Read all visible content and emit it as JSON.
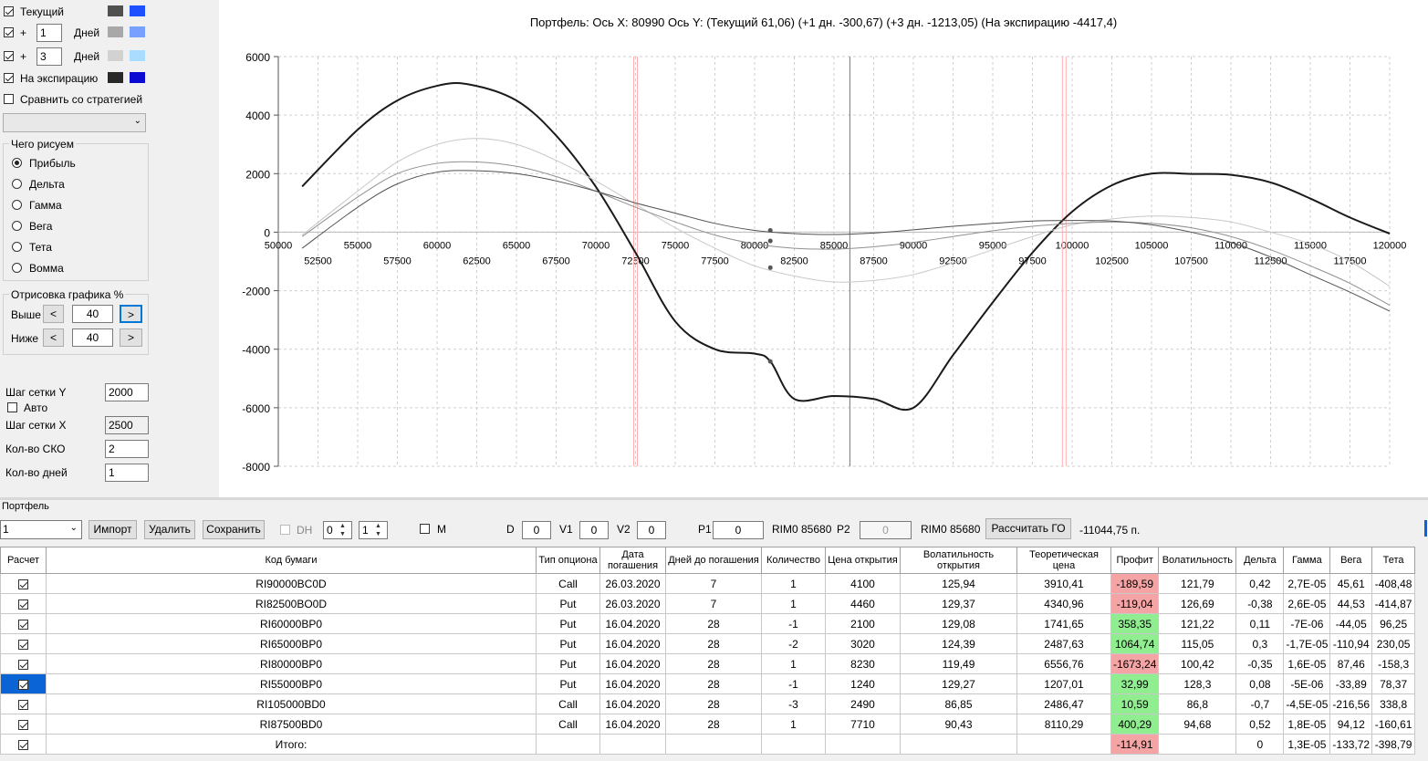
{
  "legend": {
    "current": {
      "label": "Текущий",
      "colors": [
        "#505050",
        "#1e50ff"
      ]
    },
    "plus1": {
      "prefix": "+",
      "days": "1",
      "suffix": "Дней",
      "colors": [
        "#a8a8a8",
        "#78a0ff"
      ]
    },
    "plus3": {
      "prefix": "+",
      "days": "3",
      "suffix": "Дней",
      "colors": [
        "#d2d2d2",
        "#aadcff"
      ]
    },
    "expiry": {
      "label": "На экспирацию",
      "colors": [
        "#282828",
        "#0a0ad2"
      ]
    },
    "compare": {
      "label": "Сравнить со стратегией"
    }
  },
  "draw_group": {
    "title": "Чего рисуем",
    "options": [
      "Прибыль",
      "Дельта",
      "Гамма",
      "Вега",
      "Тета",
      "Вомма"
    ],
    "selected": "Прибыль"
  },
  "range_group": {
    "title": "Отрисовка графика %",
    "above_label": "Выше",
    "above_value": "40",
    "below_label": "Ниже",
    "below_value": "40",
    "dec": "<",
    "inc": ">"
  },
  "settings": {
    "grid_y_label": "Шаг сетки Y",
    "grid_y": "2000",
    "auto_label": "Авто",
    "grid_x_label": "Шаг сетки X",
    "grid_x": "2500",
    "sko_label": "Кол-во СКО",
    "sko": "2",
    "days_label": "Кол-во дней",
    "days": "1"
  },
  "chart_title": "Портфель: Ось X: 80990 Ось Y:  (Текущий 61,06)  (+1 дн. -300,67)  (+3 дн. -1213,05)  (На экспирацию -4417,4)",
  "chart_data": {
    "type": "line",
    "xlim": [
      50000,
      120000
    ],
    "ylim": [
      -8000,
      6000
    ],
    "yticks": [
      "6000",
      "4000",
      "2000",
      "0",
      "-2000",
      "-4000",
      "-6000",
      "-8000"
    ],
    "xticks_top": [
      "50000",
      "55000",
      "60000",
      "65000",
      "70000",
      "75000",
      "80000",
      "85000",
      "90000",
      "95000",
      "100000",
      "105000",
      "110000",
      "115000",
      "120000"
    ],
    "xticks_bottom": [
      "52500",
      "57500",
      "62500",
      "67500",
      "72500",
      "77500",
      "82500",
      "87500",
      "92500",
      "97500",
      "102500",
      "107500",
      "112500",
      "117500"
    ],
    "vlines": {
      "red": [
        72500,
        99500
      ],
      "blue": [
        86000
      ]
    },
    "series": [
      {
        "key": "expiry",
        "color": "#1a1a1a",
        "width": 2,
        "x": [
          51500,
          55000,
          57500,
          60000,
          62000,
          65000,
          67500,
          70000,
          72500,
          75000,
          77500,
          80000,
          81000,
          82500,
          85000,
          87500,
          90000,
          92500,
          95000,
          97500,
          100000,
          102500,
          105000,
          107500,
          110000,
          112500,
          115000,
          117500,
          120000
        ],
        "y": [
          1560,
          3500,
          4500,
          5000,
          5050,
          4500,
          3300,
          1550,
          -700,
          -3050,
          -4000,
          -4150,
          -4420,
          -5700,
          -5600,
          -5700,
          -6000,
          -4200,
          -2400,
          -700,
          700,
          1600,
          2000,
          1990,
          1960,
          1700,
          1150,
          500,
          -50
        ]
      },
      {
        "key": "plus3",
        "color": "#c8c8c8",
        "width": 1,
        "x": [
          51500,
          55000,
          57500,
          60000,
          62500,
          65000,
          67500,
          70000,
          72500,
          75000,
          77500,
          80000,
          82500,
          85000,
          87500,
          90000,
          92500,
          95000,
          97500,
          100000,
          102500,
          105000,
          107500,
          110000,
          112500,
          115000,
          117500,
          120000
        ],
        "y": [
          -100,
          1400,
          2400,
          3000,
          3200,
          3000,
          2450,
          1750,
          950,
          150,
          -550,
          -1150,
          -1500,
          -1700,
          -1650,
          -1450,
          -1050,
          -600,
          -150,
          250,
          450,
          550,
          500,
          350,
          0,
          -400,
          -1000,
          -1850
        ]
      },
      {
        "key": "plus1",
        "color": "#909090",
        "width": 1,
        "x": [
          51500,
          55000,
          57500,
          60000,
          62500,
          65000,
          67500,
          70000,
          72500,
          75000,
          77500,
          80000,
          82500,
          85000,
          87500,
          90000,
          92500,
          95000,
          97500,
          100000,
          102500,
          105000,
          107500,
          110000,
          112500,
          115000,
          117500,
          120000
        ],
        "y": [
          -150,
          1200,
          2000,
          2350,
          2400,
          2250,
          1900,
          1400,
          850,
          350,
          -100,
          -400,
          -550,
          -580,
          -500,
          -350,
          -150,
          50,
          200,
          300,
          350,
          300,
          150,
          -150,
          -600,
          -1150,
          -1750,
          -2500
        ]
      },
      {
        "key": "current",
        "color": "#505050",
        "width": 1,
        "x": [
          51500,
          55000,
          57500,
          60000,
          62500,
          65000,
          67500,
          70000,
          72500,
          75000,
          77500,
          80000,
          82500,
          85000,
          87500,
          90000,
          92500,
          95000,
          97500,
          100000,
          102500,
          105000,
          107500,
          110000,
          112500,
          115000,
          117500,
          120000
        ],
        "y": [
          -550,
          850,
          1650,
          2050,
          2100,
          2000,
          1750,
          1400,
          1000,
          650,
          300,
          60,
          -50,
          -80,
          -30,
          80,
          200,
          300,
          380,
          400,
          380,
          250,
          0,
          -350,
          -850,
          -1450,
          -2050,
          -2700
        ]
      }
    ],
    "markers": [
      {
        "x": 80990,
        "y": 61
      },
      {
        "x": 80990,
        "y": -300
      },
      {
        "x": 80990,
        "y": -1213
      },
      {
        "x": 80990,
        "y": -4417
      }
    ]
  },
  "toolbar": {
    "portfolio_label": "Портфель",
    "portfolio_value": "1",
    "import": "Импорт",
    "delete": "Удалить",
    "save": "Сохранить",
    "dh": "DH",
    "dh1": "0",
    "dh2": "1",
    "m": "M",
    "d_label": "D",
    "d": "0",
    "v1_label": "V1",
    "v1": "0",
    "v2_label": "V2",
    "v2": "0",
    "p1_label": "P1",
    "p1": "0",
    "instr1": "RIM0 85680",
    "p2_label": "P2",
    "p2": "0",
    "instr2": "RIM0 85680",
    "calc": "Рассчитать ГО",
    "go_value": "-11044,75 п."
  },
  "table": {
    "headers": [
      "Расчет",
      "Код бумаги",
      "Тип опциона",
      "Дата погашения",
      "Дней до погашения",
      "Количество",
      "Цена открытия",
      "Волатильность открытия",
      "Теоретическая цена",
      "Профит",
      "Волатильность",
      "Дельта",
      "Гамма",
      "Вега",
      "Тета"
    ],
    "rows": [
      {
        "code": "RI90000BC0D",
        "type": "Call",
        "date": "26.03.2020",
        "days": "7",
        "qty": "1",
        "price": "4100",
        "vol_open": "125,94",
        "theo": "3910,41",
        "profit": "-189,59",
        "vol": "121,79",
        "delta": "0,42",
        "gamma": "2,7E-05",
        "vega": "45,61",
        "theta": "-408,48",
        "sign": "neg"
      },
      {
        "code": "RI82500BO0D",
        "type": "Put",
        "date": "26.03.2020",
        "days": "7",
        "qty": "1",
        "price": "4460",
        "vol_open": "129,37",
        "theo": "4340,96",
        "profit": "-119,04",
        "vol": "126,69",
        "delta": "-0,38",
        "gamma": "2,6E-05",
        "vega": "44,53",
        "theta": "-414,87",
        "sign": "neg"
      },
      {
        "code": "RI60000BP0",
        "type": "Put",
        "date": "16.04.2020",
        "days": "28",
        "qty": "-1",
        "price": "2100",
        "vol_open": "129,08",
        "theo": "1741,65",
        "profit": "358,35",
        "vol": "121,22",
        "delta": "0,11",
        "gamma": "-7E-06",
        "vega": "-44,05",
        "theta": "96,25",
        "sign": "pos"
      },
      {
        "code": "RI65000BP0",
        "type": "Put",
        "date": "16.04.2020",
        "days": "28",
        "qty": "-2",
        "price": "3020",
        "vol_open": "124,39",
        "theo": "2487,63",
        "profit": "1064,74",
        "vol": "115,05",
        "delta": "0,3",
        "gamma": "-1,7E-05",
        "vega": "-110,94",
        "theta": "230,05",
        "sign": "pos"
      },
      {
        "code": "RI80000BP0",
        "type": "Put",
        "date": "16.04.2020",
        "days": "28",
        "qty": "1",
        "price": "8230",
        "vol_open": "119,49",
        "theo": "6556,76",
        "profit": "-1673,24",
        "vol": "100,42",
        "delta": "-0,35",
        "gamma": "1,6E-05",
        "vega": "87,46",
        "theta": "-158,3",
        "sign": "neg"
      },
      {
        "code": "RI55000BP0",
        "type": "Put",
        "date": "16.04.2020",
        "days": "28",
        "qty": "-1",
        "price": "1240",
        "vol_open": "129,27",
        "theo": "1207,01",
        "profit": "32,99",
        "vol": "128,3",
        "delta": "0,08",
        "gamma": "-5E-06",
        "vega": "-33,89",
        "theta": "78,37",
        "sign": "pos",
        "selected": true
      },
      {
        "code": "RI105000BD0",
        "type": "Call",
        "date": "16.04.2020",
        "days": "28",
        "qty": "-3",
        "price": "2490",
        "vol_open": "86,85",
        "theo": "2486,47",
        "profit": "10,59",
        "vol": "86,8",
        "delta": "-0,7",
        "gamma": "-4,5E-05",
        "vega": "-216,56",
        "theta": "338,8",
        "sign": "pos"
      },
      {
        "code": "RI87500BD0",
        "type": "Call",
        "date": "16.04.2020",
        "days": "28",
        "qty": "1",
        "price": "7710",
        "vol_open": "90,43",
        "theo": "8110,29",
        "profit": "400,29",
        "vol": "94,68",
        "delta": "0,52",
        "gamma": "1,8E-05",
        "vega": "94,12",
        "theta": "-160,61",
        "sign": "pos"
      }
    ],
    "total": {
      "label": "Итого:",
      "profit": "-114,91",
      "delta": "0",
      "gamma": "1,3E-05",
      "vega": "-133,72",
      "theta": "-398,79"
    }
  }
}
